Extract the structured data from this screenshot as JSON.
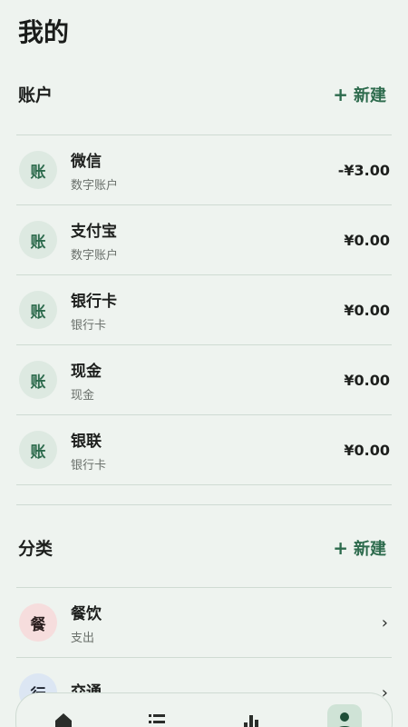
{
  "header": {
    "title": "我的"
  },
  "accounts": {
    "title": "账户",
    "new_label": "新建",
    "items": [
      {
        "badge": "账",
        "name": "微信",
        "type": "数字账户",
        "amount": "-¥3.00"
      },
      {
        "badge": "账",
        "name": "支付宝",
        "type": "数字账户",
        "amount": "¥0.00"
      },
      {
        "badge": "账",
        "name": "银行卡",
        "type": "银行卡",
        "amount": "¥0.00"
      },
      {
        "badge": "账",
        "name": "现金",
        "type": "现金",
        "amount": "¥0.00"
      },
      {
        "badge": "账",
        "name": "银联",
        "type": "银行卡",
        "amount": "¥0.00"
      }
    ]
  },
  "categories": {
    "title": "分类",
    "new_label": "新建",
    "items": [
      {
        "badge": "餐",
        "name": "餐饮",
        "type": "支出"
      },
      {
        "badge": "行",
        "name": "交通",
        "type": ""
      }
    ]
  },
  "nav": {
    "items": [
      {
        "icon": "home-icon"
      },
      {
        "icon": "list-icon"
      },
      {
        "icon": "bar-chart-icon"
      },
      {
        "icon": "person-icon"
      }
    ],
    "active": "person-icon"
  },
  "colors": {
    "accent": "#2d6b4d",
    "background": "#eef3ef",
    "divider": "#cfdbd3"
  }
}
